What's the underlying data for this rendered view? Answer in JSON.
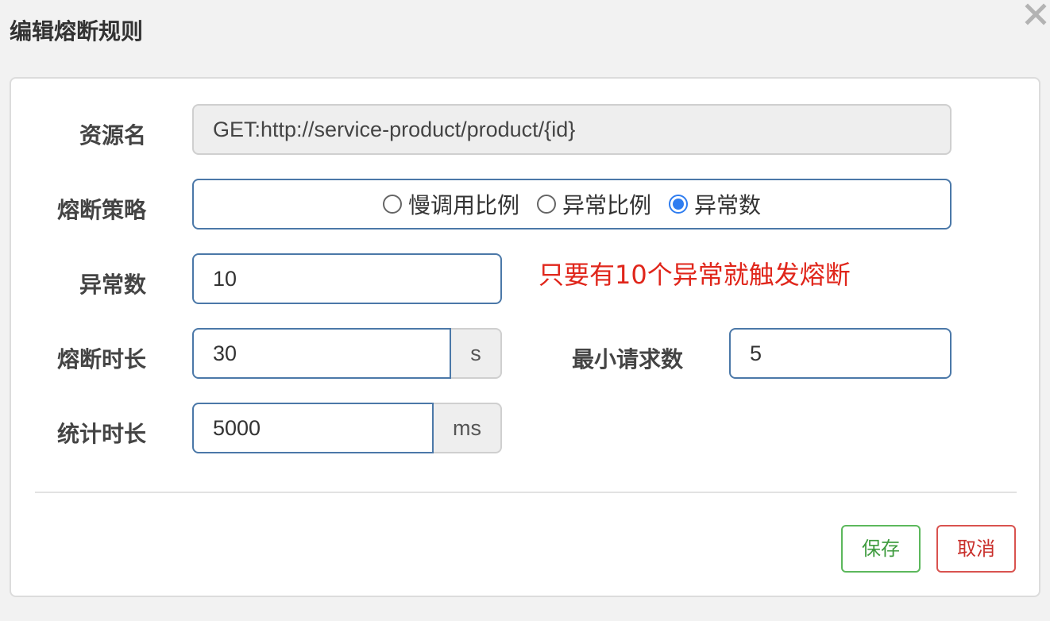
{
  "dialog": {
    "title": "编辑熔断规则",
    "close_icon": "close-icon"
  },
  "form": {
    "resource": {
      "label": "资源名",
      "value": "GET:http://service-product/product/{id}"
    },
    "strategy": {
      "label": "熔断策略",
      "options": [
        "慢调用比例",
        "异常比例",
        "异常数"
      ],
      "selected": "异常数"
    },
    "exception_count": {
      "label": "异常数",
      "value": "10"
    },
    "note": "只要有10个异常就触发熔断",
    "break_duration": {
      "label": "熔断时长",
      "value": "30",
      "unit": "s"
    },
    "min_requests": {
      "label": "最小请求数",
      "value": "5"
    },
    "stat_duration": {
      "label": "统计时长",
      "value": "5000",
      "unit": "ms"
    }
  },
  "buttons": {
    "save": "保存",
    "cancel": "取消"
  },
  "colors": {
    "accent": "#2f7df0",
    "note": "#e0261b",
    "save": "#5cb85c",
    "cancel": "#d9534f"
  }
}
